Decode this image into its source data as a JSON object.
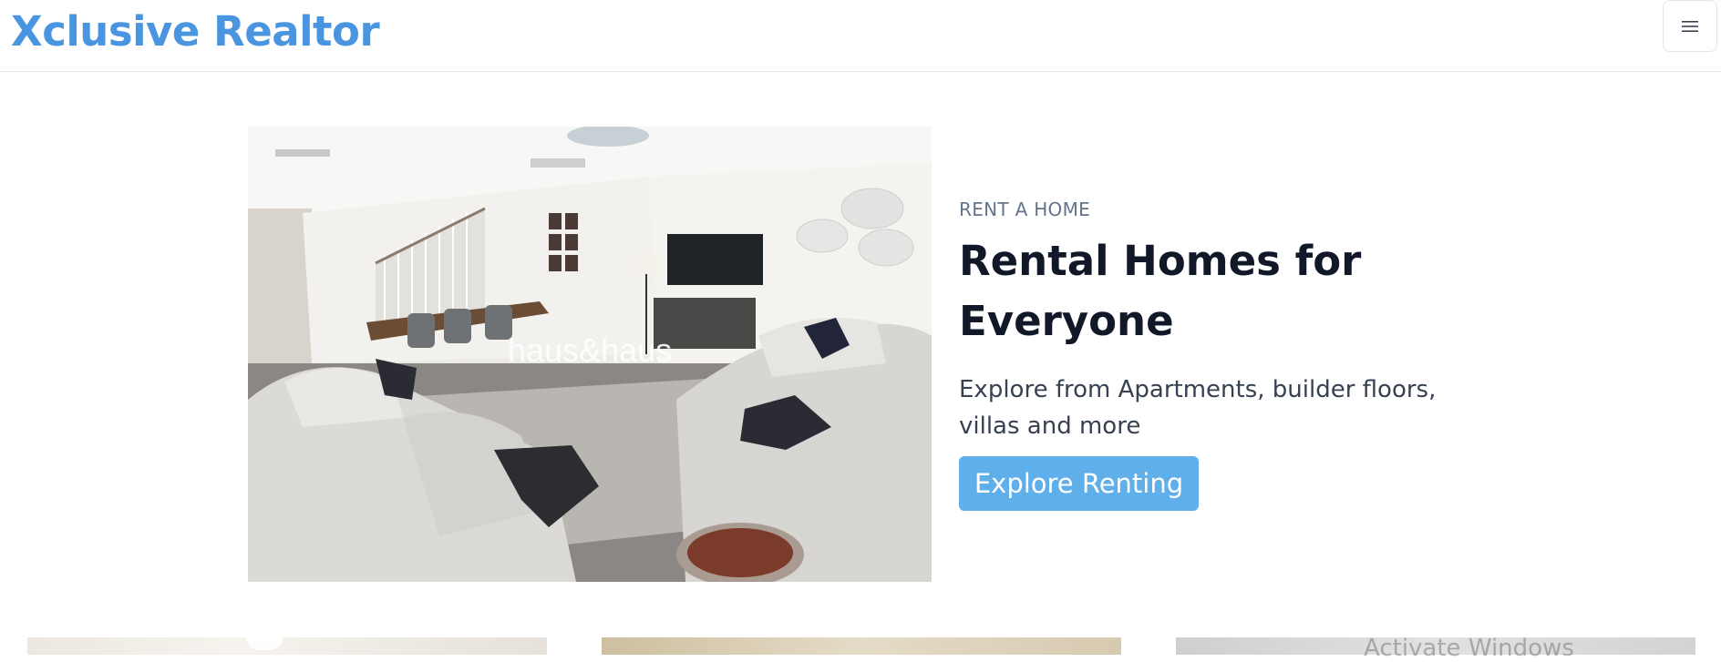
{
  "brand": {
    "name": "Xclusive Realtor",
    "color": "#4a95df"
  },
  "header": {
    "menu_icon": "hamburger-icon"
  },
  "hero": {
    "image_alt": "Modern living room with sofas, dining table and staircase",
    "eyebrow": "RENT A HOME",
    "title": "Rental Homes for Everyone",
    "description": "Explore from Apartments, builder floors, villas and more",
    "cta_label": "Explore Renting",
    "cta_color": "#5fb0ea"
  },
  "system": {
    "watermark": "Activate Windows"
  }
}
